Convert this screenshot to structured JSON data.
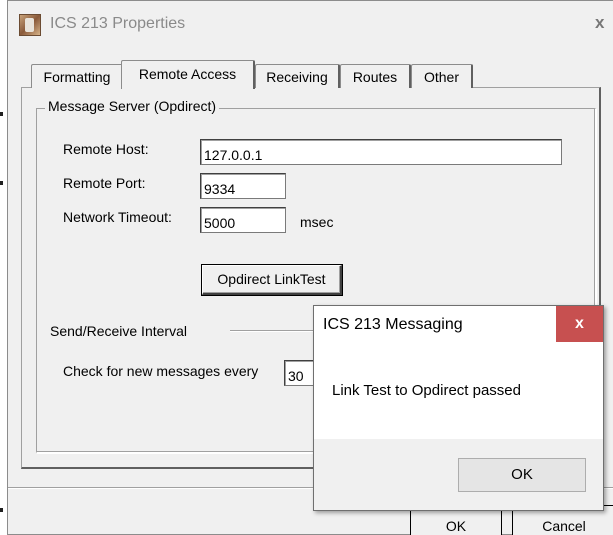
{
  "window": {
    "title": "ICS 213 Properties",
    "close_glyph": "x"
  },
  "tabs": [
    {
      "label": "Formatting"
    },
    {
      "label": "Remote Access",
      "active": true
    },
    {
      "label": "Receiving"
    },
    {
      "label": "Routes"
    },
    {
      "label": "Other"
    }
  ],
  "message_server": {
    "group_label": "Message Server (Opdirect)",
    "remote_host_label": "Remote Host:",
    "remote_host_value": "127.0.0.1",
    "remote_port_label": "Remote Port:",
    "remote_port_value": "9334",
    "network_timeout_label": "Network Timeout:",
    "network_timeout_value": "5000",
    "timeout_unit": "msec",
    "link_test_button": "Opdirect LinkTest"
  },
  "interval": {
    "section_label": "Send/Receive Interval",
    "check_label": "Check for new messages every",
    "check_value": "30"
  },
  "footer": {
    "ok_label": "OK",
    "cancel_label": "Cancel"
  },
  "dialog": {
    "title": "ICS 213 Messaging",
    "close_glyph": "x",
    "message": "Link Test to Opdirect passed",
    "ok_label": "OK",
    "close_color": "#c75050"
  }
}
